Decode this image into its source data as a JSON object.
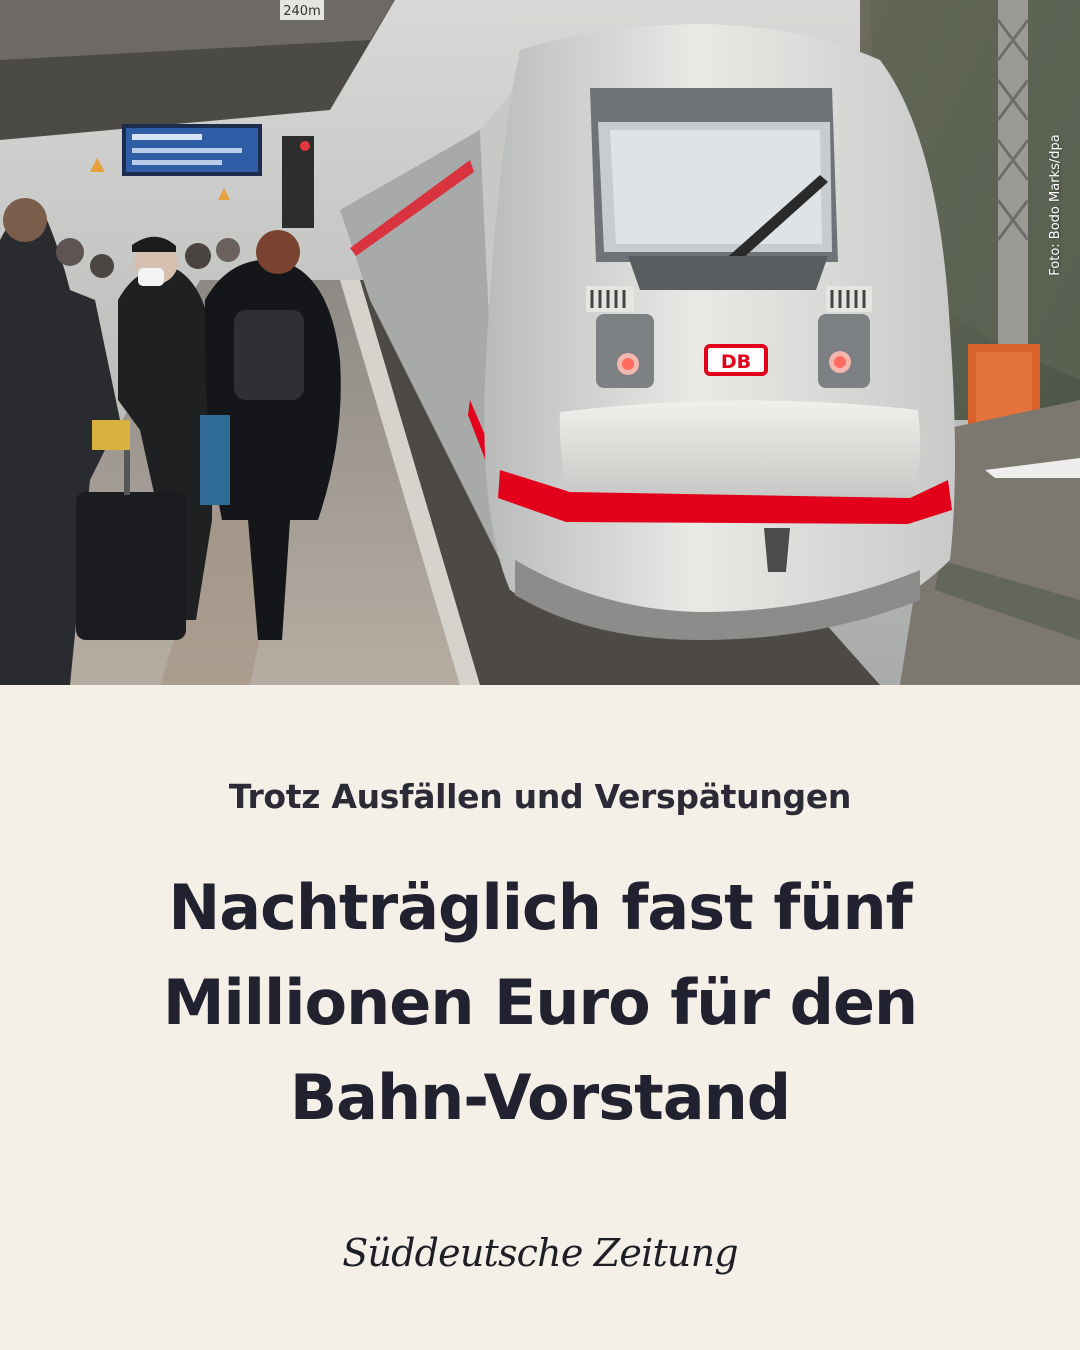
{
  "photo": {
    "credit": "Foto: Bodo Marks/dpa",
    "sign_distance": "240m",
    "train_logo": "DB"
  },
  "article": {
    "kicker": "Trotz Ausfällen und Verspätungen",
    "headline": "Nachträglich fast fünf Millionen Euro für den Bahn-Vorstand"
  },
  "brand": {
    "masthead": "Süddeutsche Zeitung"
  },
  "colors": {
    "background": "#f4f0e8",
    "text": "#222130",
    "db_red": "#e2001a"
  }
}
